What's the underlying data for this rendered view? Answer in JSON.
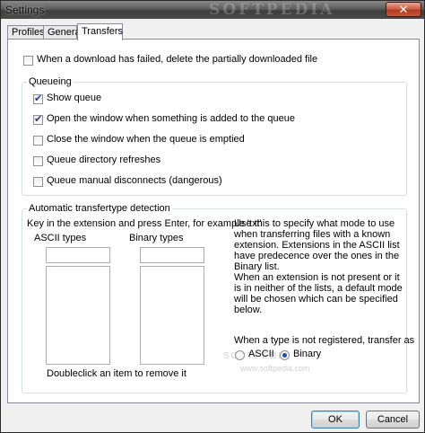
{
  "window": {
    "title": "Settings",
    "watermark": "SOFTPEDIA",
    "close_glyph": "✕"
  },
  "tabs": [
    {
      "label": "Profiles",
      "active": false
    },
    {
      "label": "General",
      "active": false
    },
    {
      "label": "Transfers",
      "active": true
    }
  ],
  "transfers": {
    "delete_failed": {
      "label": "When a download has failed, delete the partially downloaded file",
      "checked": false
    },
    "queueing": {
      "title": "Queueing",
      "options": [
        {
          "label": "Show queue",
          "checked": true
        },
        {
          "label": "Open the window when something is added to the queue",
          "checked": true
        },
        {
          "label": "Close the window when the queue is emptied",
          "checked": false
        },
        {
          "label": "Queue directory refreshes",
          "checked": false
        },
        {
          "label": "Queue manual disconnects (dangerous)",
          "checked": false
        }
      ]
    },
    "auto_type": {
      "title": "Automatic transfertype detection",
      "instruction": "Key in the extension and press Enter, for example 'txt'",
      "ascii_label": "ASCII types",
      "binary_label": "Binary types",
      "ascii_input": "",
      "binary_input": "",
      "remove_hint": "Doubleclick an item to remove it",
      "description_1": "Use this to specify what mode to use when transferring files with a known extension. Extensions in the ASCII list have predecence over the ones in the Binary list.",
      "description_2": "When an extension is not present or it is in neither of the lists, a default mode will be chosen which can be specified below.",
      "default_label": "When a type is not registered, transfer as",
      "radio_ascii": "ASCII",
      "radio_binary": "Binary",
      "selected_default": "Binary",
      "watermark_text": "www.softpedia.com",
      "watermark_brand": "SOFTPEDIA"
    }
  },
  "footer": {
    "ok_label": "OK",
    "cancel_label": "Cancel"
  }
}
